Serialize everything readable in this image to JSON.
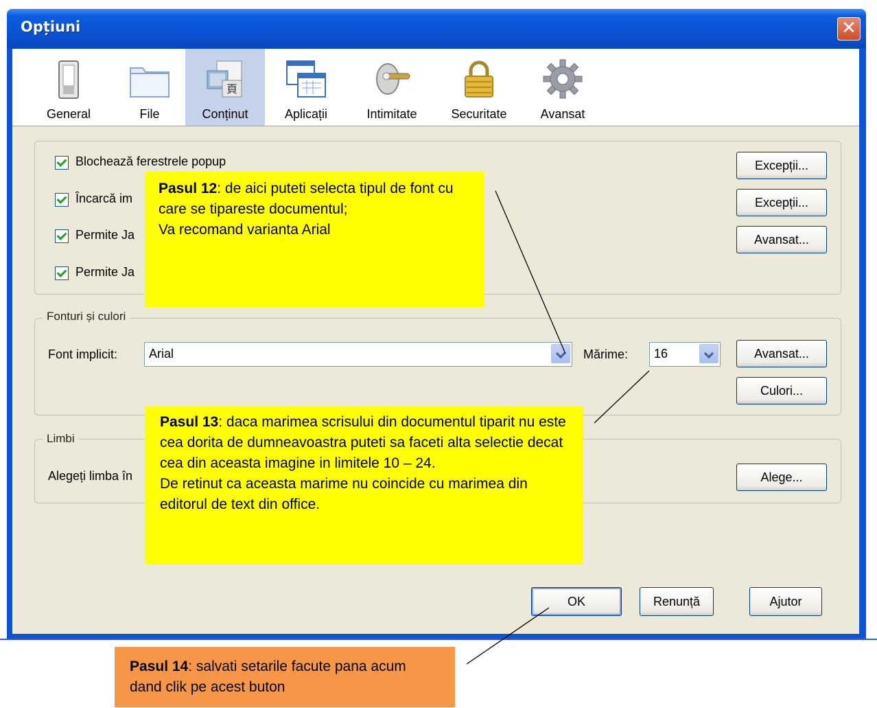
{
  "window": {
    "title": "Opțiuni",
    "close_glyph": "✕"
  },
  "tabs": [
    {
      "label": "General",
      "icon": "switch-icon"
    },
    {
      "label": "File",
      "icon": "folder-icon"
    },
    {
      "label": "Conținut",
      "icon": "content-icon",
      "selected": true
    },
    {
      "label": "Aplicații",
      "icon": "applications-icon"
    },
    {
      "label": "Intimitate",
      "icon": "privacy-mask-icon"
    },
    {
      "label": "Securitate",
      "icon": "padlock-icon"
    },
    {
      "label": "Avansat",
      "icon": "gear-icon"
    }
  ],
  "content": {
    "checkboxes": [
      {
        "label": "Blochează ferestrele popup",
        "checked": true
      },
      {
        "label": "Încarcă im",
        "checked": true
      },
      {
        "label": "Permite Ja",
        "checked": true
      },
      {
        "label": "Permite Ja",
        "checked": true
      }
    ],
    "side_buttons": [
      "Excepții...",
      "Excepții...",
      "Avansat..."
    ]
  },
  "fonts": {
    "legend": "Fonturi și culori",
    "font_label": "Font implicit:",
    "font_value": "Arial",
    "size_label": "Mărime:",
    "size_value": "16",
    "advanced_button": "Avansat...",
    "colors_button": "Culori..."
  },
  "languages": {
    "legend": "Limbi",
    "label": "Alegeți limba în",
    "choose_button": "Alege..."
  },
  "footer": {
    "ok": "OK",
    "cancel": "Renunță",
    "help": "Ajutor"
  },
  "callouts": {
    "step12": {
      "title": "Pasul 12",
      "text": ": de aici puteti selecta tipul de font cu care se tipareste documentul;",
      "text2": "Va recomand varianta Arial"
    },
    "step13": {
      "title": "Pasul 13",
      "text": ": daca marimea scrisului din documentul tiparit nu este cea dorita de dumneavoastra puteti sa faceti alta selectie decat cea din aceasta imagine in limitele 10 – 24.",
      "text2": "De retinut ca aceasta marime nu coincide cu marimea din editorul de text din office."
    },
    "step14": {
      "title": "Pasul 14",
      "text": ": salvati setarile facute pana acum dand clik pe acest buton"
    }
  },
  "colors": {
    "callout_yellow": "#ffff00",
    "callout_orange": "#f79646",
    "titlebar": "#0a55d8",
    "dialog_bg": "#ece9d8"
  }
}
